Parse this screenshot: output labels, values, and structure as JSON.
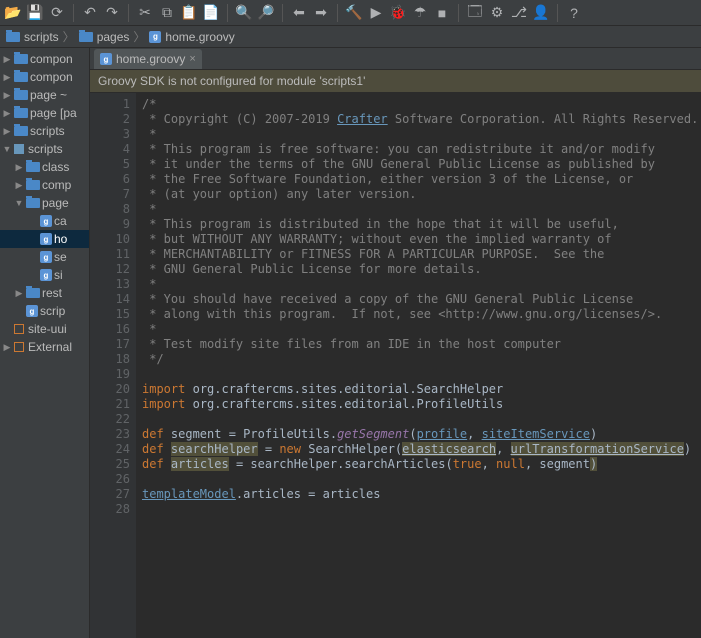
{
  "toolbar": {
    "icons": [
      "open",
      "save",
      "refresh",
      "sep",
      "undo",
      "redo",
      "sep",
      "cut",
      "copy",
      "paste",
      "clipboard",
      "sep",
      "zoom-in",
      "zoom-out",
      "sep",
      "back",
      "forward",
      "sep",
      "build",
      "run",
      "debug",
      "coverage",
      "stop",
      "sep",
      "layout",
      "tools",
      "git",
      "profile",
      "sep",
      "help"
    ]
  },
  "breadcrumb": {
    "items": [
      {
        "type": "folder",
        "label": "scripts"
      },
      {
        "type": "folder",
        "label": "pages"
      },
      {
        "type": "groovy",
        "label": "home.groovy"
      }
    ]
  },
  "tree": [
    {
      "indent": 0,
      "arrow": "right",
      "icon": "folder",
      "label": "compon"
    },
    {
      "indent": 0,
      "arrow": "right",
      "icon": "folder",
      "label": "compon"
    },
    {
      "indent": 0,
      "arrow": "right",
      "icon": "folder",
      "label": "page ~"
    },
    {
      "indent": 0,
      "arrow": "right",
      "icon": "folder",
      "label": "page [pa"
    },
    {
      "indent": 0,
      "arrow": "right",
      "icon": "folder",
      "label": "scripts"
    },
    {
      "indent": 0,
      "arrow": "down",
      "icon": "module",
      "label": "scripts"
    },
    {
      "indent": 1,
      "arrow": "right",
      "icon": "folder",
      "label": "class"
    },
    {
      "indent": 1,
      "arrow": "right",
      "icon": "folder",
      "label": "comp"
    },
    {
      "indent": 1,
      "arrow": "down",
      "icon": "folder",
      "label": "page"
    },
    {
      "indent": 2,
      "arrow": "none",
      "icon": "groovy",
      "label": "ca"
    },
    {
      "indent": 2,
      "arrow": "none",
      "icon": "groovy",
      "label": "ho",
      "sel": true
    },
    {
      "indent": 2,
      "arrow": "none",
      "icon": "groovy",
      "label": "se"
    },
    {
      "indent": 2,
      "arrow": "none",
      "icon": "groovy",
      "label": "si"
    },
    {
      "indent": 1,
      "arrow": "right",
      "icon": "folder",
      "label": "rest"
    },
    {
      "indent": 1,
      "arrow": "none",
      "icon": "groovy",
      "label": "scrip"
    },
    {
      "indent": 0,
      "arrow": "none",
      "icon": "lib",
      "label": "site-uui"
    },
    {
      "indent": 0,
      "arrow": "right",
      "icon": "lib",
      "label": "External"
    }
  ],
  "tab": {
    "label": "home.groovy"
  },
  "warning": "Groovy SDK is not configured for module 'scripts1'",
  "code": {
    "lines": [
      {
        "n": 1,
        "t": "comment",
        "v": "/*"
      },
      {
        "n": 2,
        "t": "raw",
        "v": " * Copyright (C) 2007-2019 <u>Crafter</u> Software Corporation. All Rights Reserved."
      },
      {
        "n": 3,
        "t": "comment",
        "v": " *"
      },
      {
        "n": 4,
        "t": "comment",
        "v": " * This program is free software: you can redistribute it and/or modify"
      },
      {
        "n": 5,
        "t": "comment",
        "v": " * it under the terms of the GNU General Public License as published by"
      },
      {
        "n": 6,
        "t": "comment",
        "v": " * the Free Software Foundation, either version 3 of the License, or"
      },
      {
        "n": 7,
        "t": "comment",
        "v": " * (at your option) any later version."
      },
      {
        "n": 8,
        "t": "comment",
        "v": " *"
      },
      {
        "n": 9,
        "t": "comment",
        "v": " * This program is distributed in the hope that it will be useful,"
      },
      {
        "n": 10,
        "t": "comment",
        "v": " * but WITHOUT ANY WARRANTY; without even the implied warranty of"
      },
      {
        "n": 11,
        "t": "comment",
        "v": " * MERCHANTABILITY or FITNESS FOR A PARTICULAR PURPOSE.  See the"
      },
      {
        "n": 12,
        "t": "comment",
        "v": " * GNU General Public License for more details."
      },
      {
        "n": 13,
        "t": "comment",
        "v": " *"
      },
      {
        "n": 14,
        "t": "comment",
        "v": " * You should have received a copy of the GNU General Public License"
      },
      {
        "n": 15,
        "t": "comment",
        "v": " * along with this program.  If not, see <http://www.gnu.org/licenses/>."
      },
      {
        "n": 16,
        "t": "comment",
        "v": " *"
      },
      {
        "n": 17,
        "t": "comment",
        "v": " * Test modify site files from an IDE in the host computer"
      },
      {
        "n": 18,
        "t": "comment",
        "v": " */"
      },
      {
        "n": 19,
        "t": "blank",
        "v": ""
      },
      {
        "n": 20,
        "t": "import",
        "pkg": "org.craftercms.sites.editorial.SearchHelper"
      },
      {
        "n": 21,
        "t": "import",
        "pkg": "org.craftercms.sites.editorial.ProfileUtils"
      },
      {
        "n": 22,
        "t": "blank",
        "v": ""
      },
      {
        "n": 23,
        "t": "def",
        "name": "segment",
        "rhs": " = ProfileUtils.<i>getSegment</i>(<u>profile</u>, <u>siteItemService</u>)"
      },
      {
        "n": 24,
        "t": "def",
        "name": "searchHelper",
        "warnName": true,
        "rhs": " = <k>new</k> SearchHelper(<wu>elasticsearch</wu>, <wu>urlTransformationService</wu>)"
      },
      {
        "n": 25,
        "t": "def",
        "name": "articles",
        "warnName": true,
        "rhs": " = searchHelper.searchArticles(<k>true</k>, <k>null</k>, segment<w>)</w>"
      },
      {
        "n": 26,
        "t": "blank",
        "v": ""
      },
      {
        "n": 27,
        "t": "plain",
        "v": "<u>templateModel</u>.articles = articles"
      },
      {
        "n": 28,
        "t": "blank",
        "v": ""
      }
    ]
  }
}
